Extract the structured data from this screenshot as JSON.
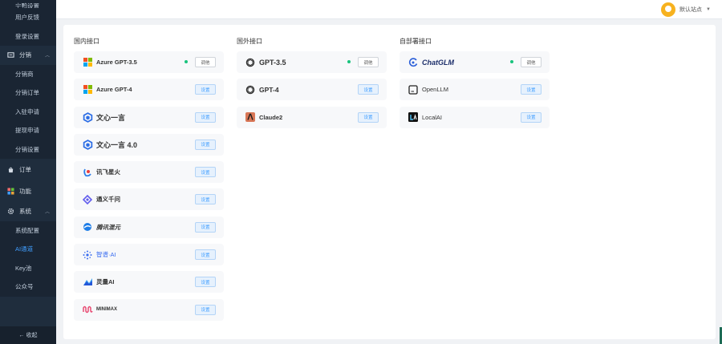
{
  "sidebar": {
    "partial_label": "宁鸭设置",
    "items_top": [
      {
        "label": "用户反馈"
      },
      {
        "label": "登录设置"
      }
    ],
    "group_fenxiao": {
      "label": "分销"
    },
    "items_fenxiao": [
      {
        "label": "分销商"
      },
      {
        "label": "分销订单"
      },
      {
        "label": "入驻申请"
      },
      {
        "label": "提现申请"
      },
      {
        "label": "分销设置"
      }
    ],
    "group_order": {
      "label": "订单"
    },
    "group_feature": {
      "label": "功能"
    },
    "group_system": {
      "label": "系统"
    },
    "items_system": [
      {
        "label": "系统配置"
      },
      {
        "label": "AI通道"
      },
      {
        "label": "Key池"
      },
      {
        "label": "公众号"
      }
    ],
    "collapse_label": "← 收起"
  },
  "header": {
    "username": "默认站点"
  },
  "columns": {
    "domestic": {
      "title": "国内接口",
      "rows": [
        {
          "name": "Azure GPT-3.5",
          "button": "调他"
        },
        {
          "name": "Azure GPT-4",
          "button": "设置"
        },
        {
          "name": "文心一言",
          "button": "设置"
        },
        {
          "name": "文心一言 4.0",
          "button": "设置"
        },
        {
          "name": "讯飞星火",
          "button": "设置"
        },
        {
          "name": "通义千问",
          "button": "设置"
        },
        {
          "name": "腾讯混元",
          "button": "设置"
        },
        {
          "name": "智谱·AI",
          "button": "设置"
        },
        {
          "name": "灵量AI",
          "button": "设置"
        },
        {
          "name": "MINIMAX",
          "button": "设置"
        }
      ]
    },
    "foreign": {
      "title": "国外接口",
      "rows": [
        {
          "name": "GPT-3.5",
          "button": "调他"
        },
        {
          "name": "GPT-4",
          "button": "设置"
        },
        {
          "name": "Claude2",
          "button": "设置"
        }
      ]
    },
    "selfhost": {
      "title": "自部署接口",
      "rows": [
        {
          "name": "ChatGLM",
          "button": "调他"
        },
        {
          "name": "OpenLLM",
          "button": "设置"
        },
        {
          "name": "LocalAI",
          "button": "设置"
        }
      ]
    }
  },
  "colors": {
    "sidebar_bg": "#1f2d3d",
    "active_blue": "#409eff",
    "online_green": "#19c37d",
    "avatar_yellow": "#f7b21f"
  }
}
